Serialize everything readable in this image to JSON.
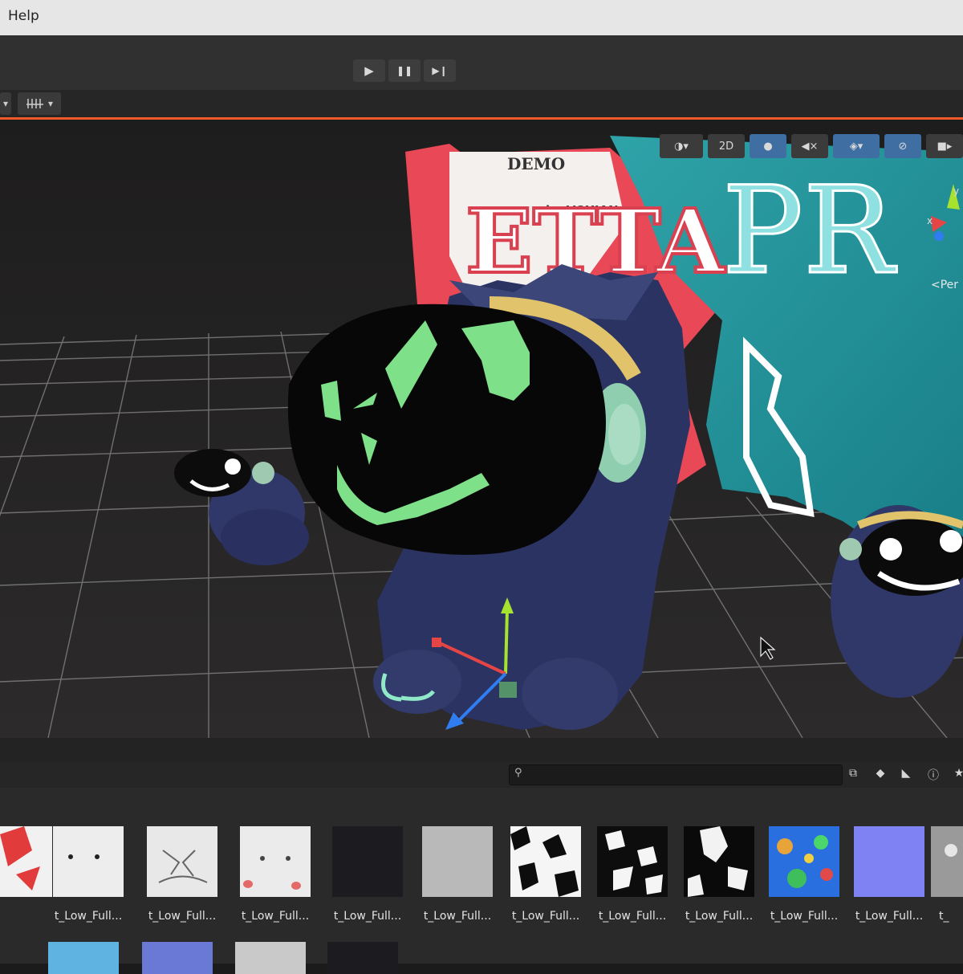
{
  "menubar": {
    "help": "Help"
  },
  "toolbar": {
    "play": "▶",
    "pause": "❚❚",
    "step": "▶❙"
  },
  "scene_toolbar": {
    "mode_2d": "2D"
  },
  "scene": {
    "banner_demo": "DEMO",
    "banner_by": "by VOXIAN",
    "banner_word1": "ETTA",
    "banner_word2": "PR",
    "gizmo_label": "<Per",
    "axis_y": "y",
    "axis_x": "x"
  },
  "project": {
    "assets": [
      {
        "label": ""
      },
      {
        "label": "t_Low_Full..."
      },
      {
        "label": "t_Low_Full..."
      },
      {
        "label": "t_Low_Full..."
      },
      {
        "label": "t_Low_Full..."
      },
      {
        "label": "t_Low_Full..."
      },
      {
        "label": "t_Low_Full..."
      },
      {
        "label": "t_Low_Full..."
      },
      {
        "label": "t_Low_Full..."
      },
      {
        "label": "t_Low_Full..."
      },
      {
        "label": "t_Low_Full..."
      },
      {
        "label": "t_"
      }
    ]
  },
  "colors": {
    "accent_orange": "#f05a28",
    "active_blue": "#3f6ea3",
    "mask_green": "#7fe08a"
  }
}
